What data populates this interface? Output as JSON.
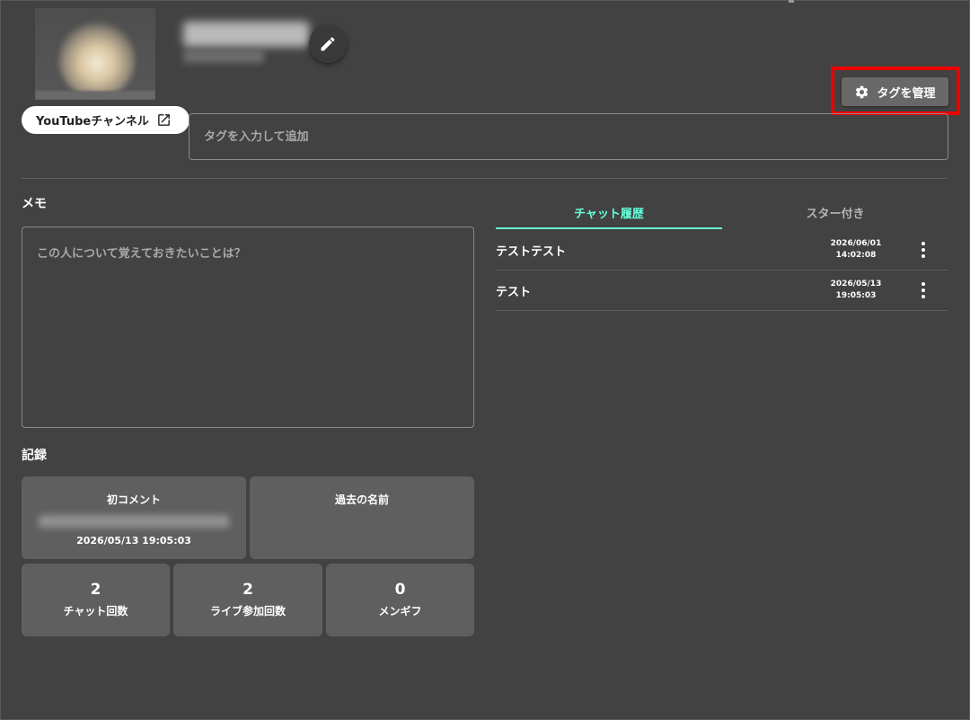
{
  "header": {
    "youtube_label": "YouTubeチャンネル",
    "manage_tags_label": "タグを管理"
  },
  "tags": {
    "input_placeholder": "タグを入力して追加"
  },
  "memo": {
    "title": "メモ",
    "placeholder": "この人について覚えておきたいことは？"
  },
  "records": {
    "title": "記録",
    "first_comment": {
      "title": "初コメント",
      "date": "2026/05/13 19:05:03"
    },
    "past_names": {
      "title": "過去の名前"
    },
    "stats": [
      {
        "value": "2",
        "label": "チャット回数"
      },
      {
        "value": "2",
        "label": "ライブ参加回数"
      },
      {
        "value": "0",
        "label": "メンギフ"
      }
    ]
  },
  "tabs": [
    {
      "label": "チャット履歴",
      "active": true
    },
    {
      "label": "スター付き",
      "active": false
    }
  ],
  "chats": [
    {
      "text": "テストテスト",
      "date": "2026/06/01",
      "time": "14:02:08"
    },
    {
      "text": "テスト",
      "date": "2026/05/13",
      "time": "19:05:03"
    }
  ],
  "colors": {
    "background": "#424242",
    "accent": "#64ffda",
    "highlight": "#ee0000",
    "card": "#5f5f5f"
  },
  "icons": [
    "edit-icon",
    "open-in-new-icon",
    "gear-icon",
    "more-vert-icon"
  ]
}
